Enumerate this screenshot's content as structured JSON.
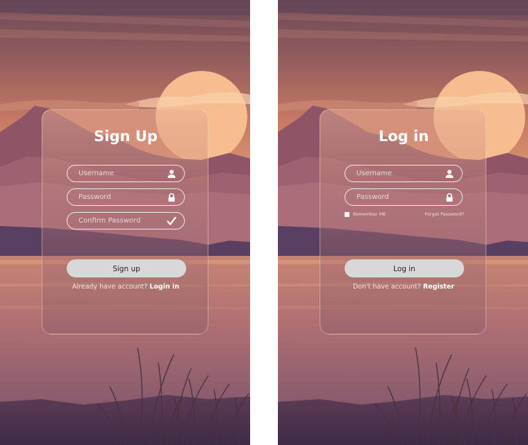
{
  "signup": {
    "title": "Sign Up",
    "username_placeholder": "Username",
    "password_placeholder": "Password",
    "confirm_placeholder": "Confirm Password",
    "button_label": "Sign up",
    "switch_text": "Already have account?",
    "switch_link": "Login in"
  },
  "login": {
    "title": "Log in",
    "username_placeholder": "Username",
    "password_placeholder": "Password",
    "remember_label": "Remember ME",
    "forgot_label": "Forgot Password?",
    "button_label": "Log in",
    "switch_text": "Don't have account?",
    "switch_link": "Register"
  },
  "icons": {
    "username": "user-icon",
    "password": "lock-icon",
    "confirm": "checkmark-icon"
  },
  "colors": {
    "button_bg": "#d8d8d8",
    "button_text": "#1f1f1f",
    "text": "#ffffff",
    "sun": "#f6be8e"
  }
}
